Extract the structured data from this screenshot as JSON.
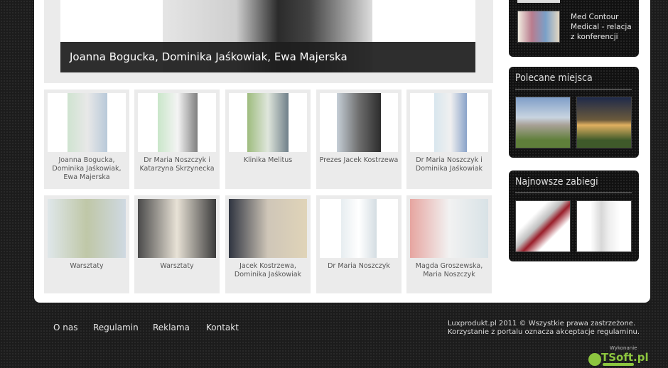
{
  "hero": {
    "caption": "Joanna Bogucka, Dominika Jaśkowiak, Ewa Majerska"
  },
  "gallery": [
    {
      "caption": "Joanna Bogucka, Dominika Jaśkowiak, Ewa Majerska"
    },
    {
      "caption": "Dr Maria Noszczyk i Katarzyna Skrzynecka"
    },
    {
      "caption": "Klinika Melitus"
    },
    {
      "caption": "Prezes Jacek Kostrzewa"
    },
    {
      "caption": "Dr Maria Noszczyk i Dominika Jaśkowiak"
    },
    {
      "caption": "Warsztaty"
    },
    {
      "caption": "Warsztaty"
    },
    {
      "caption": "Jacek Kostrzewa, Dominika Jaśkowiak"
    },
    {
      "caption": "Dr Maria Noszczyk"
    },
    {
      "caption": "Magda Groszewska, Maria Noszczyk"
    }
  ],
  "sidebar": {
    "news_item": "Med Contour Medical - relacja z konferencji",
    "polecane_title": "Polecane miejsca",
    "zabiegi_title": "Najnowsze zabiegi"
  },
  "footer": {
    "links": [
      "O nas",
      "Regulamin",
      "Reklama",
      "Kontakt"
    ],
    "copyright_line1": "Luxprodukt.pl 2011 © Wszystkie prawa zastrzeżone.",
    "copyright_line2": "Korzystanie z portalu oznacza akceptacje regulaminu.",
    "made_by_label": "Wykonanie",
    "made_by_logo": "TSoft.pl"
  }
}
